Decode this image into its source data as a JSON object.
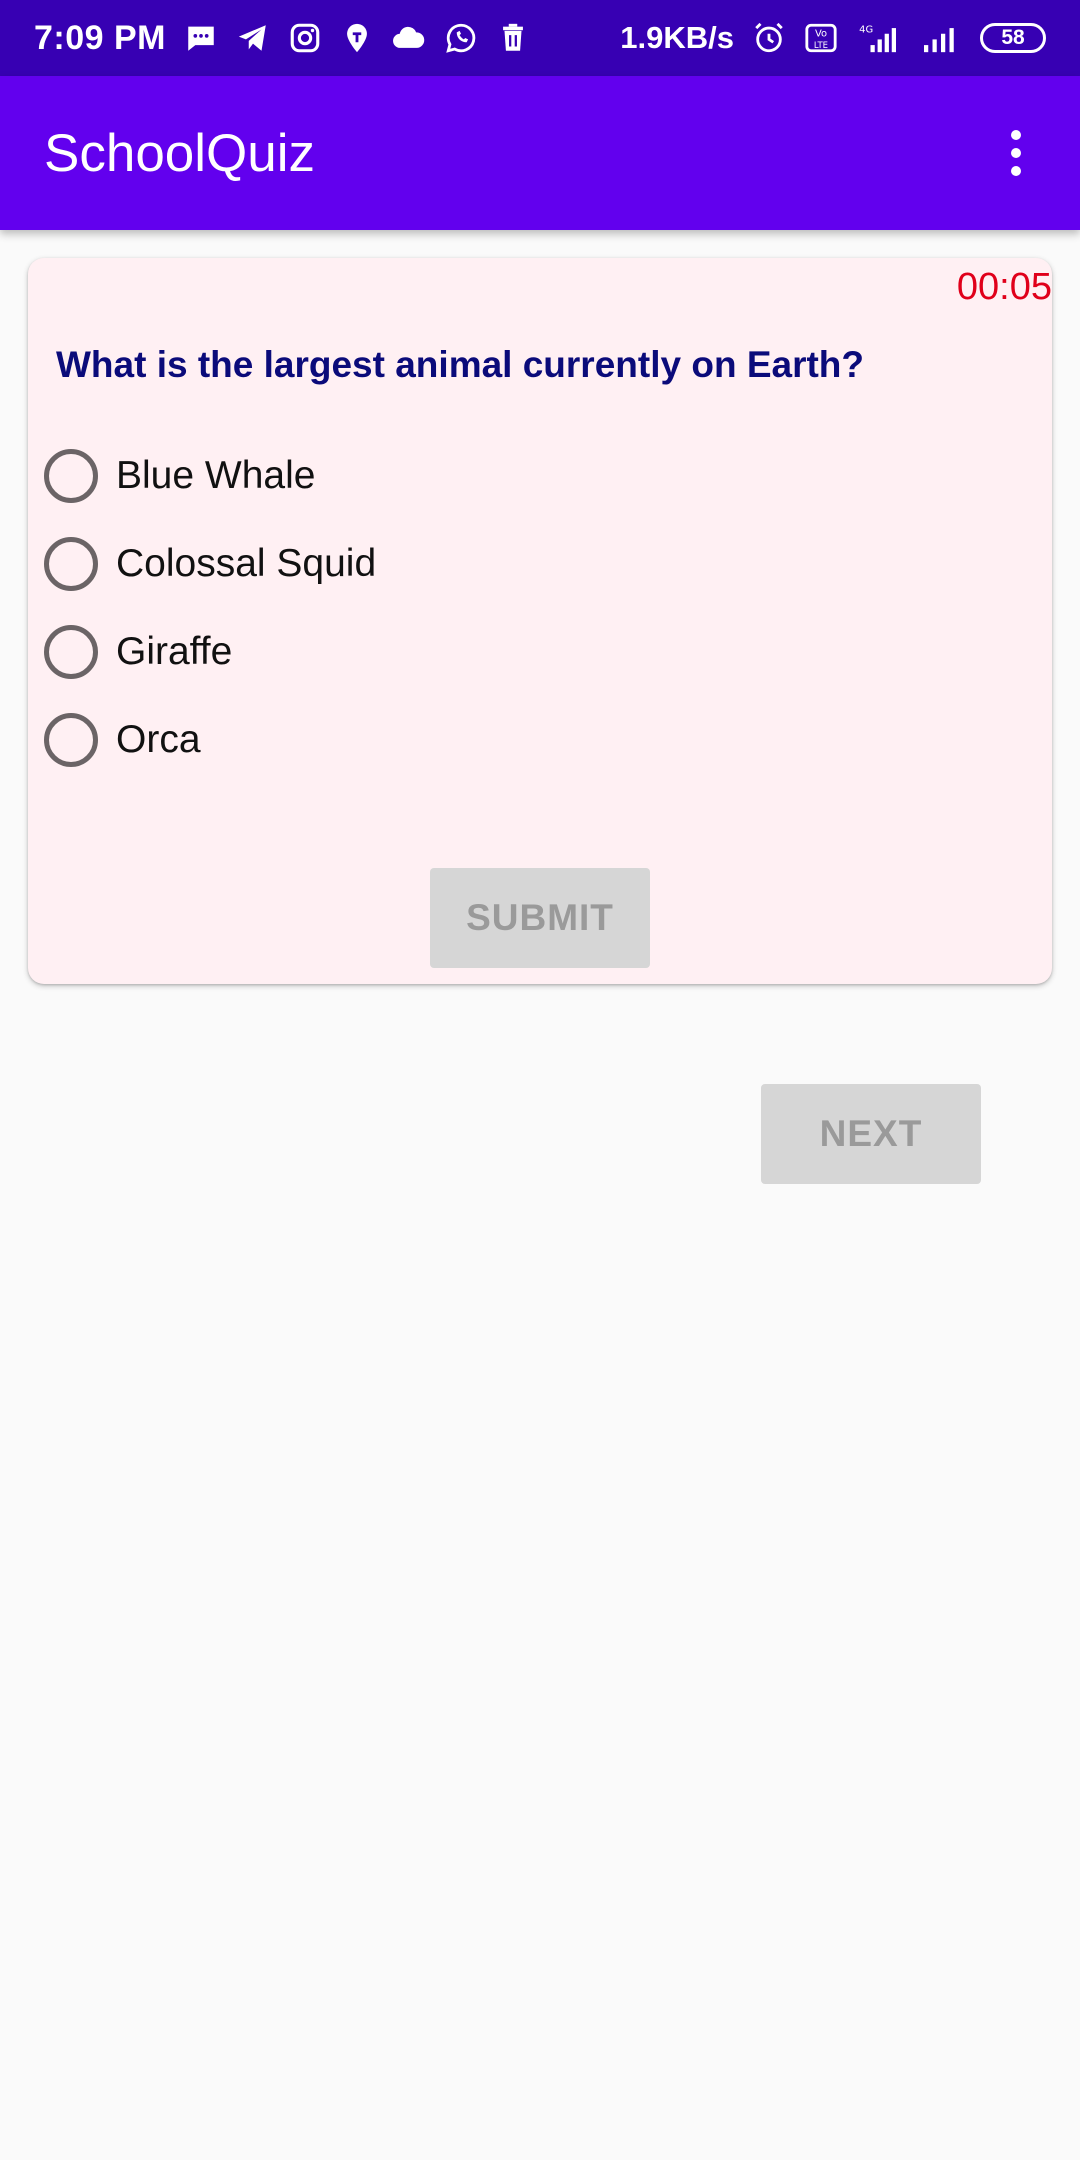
{
  "status_bar": {
    "time": "7:09 PM",
    "network_speed": "1.9KB/s",
    "battery": "58",
    "network_type": "4G",
    "volte": "Vo LTE",
    "notification_icons": [
      "message-icon",
      "telegram-icon",
      "instagram-icon",
      "swiggy-icon",
      "cloud-icon",
      "whatsapp-icon",
      "delete-icon"
    ],
    "right_icons": [
      "alarm-icon",
      "volte-icon",
      "signal-icon",
      "signal-icon"
    ]
  },
  "app_bar": {
    "title": "SchoolQuiz",
    "overflow_icon": "more-vert-icon"
  },
  "quiz": {
    "timer": "00:05",
    "question": "What is the largest animal currently on Earth?",
    "options": [
      {
        "label": "Blue Whale",
        "selected": false
      },
      {
        "label": "Colossal Squid",
        "selected": false
      },
      {
        "label": "Giraffe",
        "selected": false
      },
      {
        "label": "Orca",
        "selected": false
      }
    ],
    "submit_label": "SUBMIT"
  },
  "next_label": "NEXT",
  "colors": {
    "status_bar": "#3700b3",
    "app_bar": "#6200ee",
    "card_background": "#fff0f3",
    "question_text": "#0b0b7a",
    "timer_text": "#e0001a",
    "disabled_button": "#d6d6d6"
  }
}
